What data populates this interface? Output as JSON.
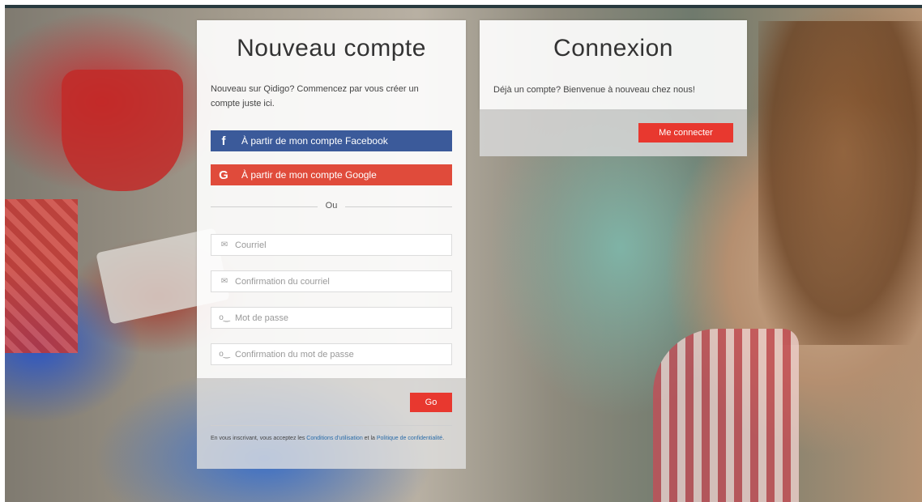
{
  "signup": {
    "title": "Nouveau compte",
    "intro": "Nouveau sur Qidigo? Commencez par vous créer un compte juste ici.",
    "facebook_label": "À partir de mon compte Facebook",
    "google_label": "À partir de mon compte Google",
    "divider_text": "Ou",
    "fields": [
      {
        "placeholder": "Courriel",
        "icon": "envelope-icon"
      },
      {
        "placeholder": "Confirmation du courriel",
        "icon": "envelope-icon"
      },
      {
        "placeholder": "Mot de passe",
        "icon": "key-icon"
      },
      {
        "placeholder": "Confirmation du mot de passe",
        "icon": "key-icon"
      }
    ],
    "submit_label": "Go",
    "legal": {
      "prefix": "En vous inscrivant, vous acceptez les ",
      "terms_link": "Conditions d'utilisation",
      "middle": " et la ",
      "privacy_link": "Politique de confidentialité",
      "suffix": "."
    }
  },
  "login": {
    "title": "Connexion",
    "intro": "Déjà un compte? Bienvenue à nouveau chez nous!",
    "button_label": "Me connecter"
  },
  "colors": {
    "facebook": "#3b5a9a",
    "google": "#e04b3b",
    "accent_red": "#e8382f",
    "link": "#2a6ca8"
  }
}
